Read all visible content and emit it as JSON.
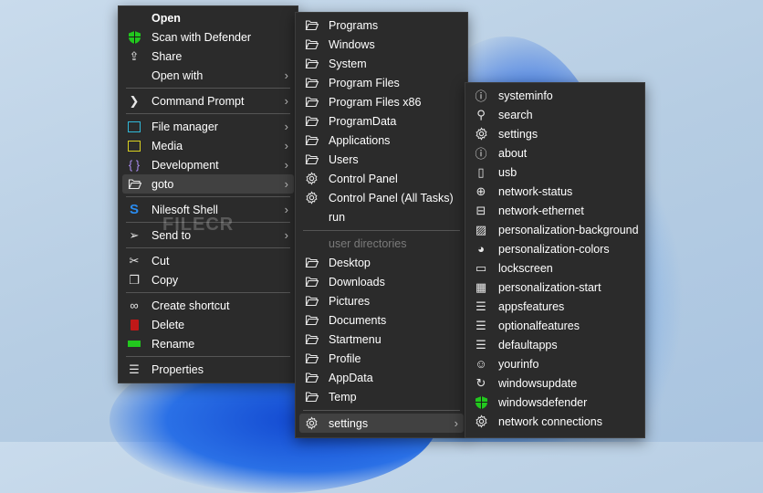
{
  "menus": {
    "main": [
      {
        "label": "Open",
        "bold": true,
        "icon": "none-icon"
      },
      {
        "label": "Scan with Defender",
        "icon": "shield-icon"
      },
      {
        "label": "Share",
        "icon": "share-icon"
      },
      {
        "label": "Open with",
        "icon": "none-icon",
        "sub": true
      },
      {
        "sep": true
      },
      {
        "label": "Command Prompt",
        "icon": "prompt-icon",
        "sub": true
      },
      {
        "sep": true
      },
      {
        "label": "File manager",
        "icon": "file-manager-icon",
        "sub": true
      },
      {
        "label": "Media",
        "icon": "media-icon",
        "sub": true
      },
      {
        "label": "Development",
        "icon": "braces-icon",
        "sub": true
      },
      {
        "label": "goto",
        "icon": "folder-icon",
        "sub": true,
        "hl": true
      },
      {
        "sep": true
      },
      {
        "label": "Nilesoft Shell",
        "icon": "nilesoft-icon",
        "sub": true
      },
      {
        "sep": true
      },
      {
        "label": "Send to",
        "icon": "send-icon",
        "sub": true
      },
      {
        "sep": true
      },
      {
        "label": "Cut",
        "icon": "cut-icon"
      },
      {
        "label": "Copy",
        "icon": "copy-icon"
      },
      {
        "sep": true
      },
      {
        "label": "Create shortcut",
        "icon": "link-icon"
      },
      {
        "label": "Delete",
        "icon": "delete-icon"
      },
      {
        "label": "Rename",
        "icon": "rename-icon"
      },
      {
        "sep": true
      },
      {
        "label": "Properties",
        "icon": "properties-icon"
      }
    ],
    "goto": [
      {
        "label": "Programs",
        "icon": "folder-icon"
      },
      {
        "label": "Windows",
        "icon": "folder-icon"
      },
      {
        "label": "System",
        "icon": "folder-icon"
      },
      {
        "label": "Program Files",
        "icon": "folder-icon"
      },
      {
        "label": "Program Files x86",
        "icon": "folder-icon"
      },
      {
        "label": "ProgramData",
        "icon": "folder-icon"
      },
      {
        "label": "Applications",
        "icon": "folder-icon"
      },
      {
        "label": "Users",
        "icon": "folder-icon"
      },
      {
        "label": "Control Panel",
        "icon": "gear-icon"
      },
      {
        "label": "Control Panel (All Tasks)",
        "icon": "gear-icon"
      },
      {
        "label": "run",
        "icon": "none-icon"
      },
      {
        "sep": true
      },
      {
        "label": "user directories",
        "icon": "none-icon",
        "dim": true
      },
      {
        "label": "Desktop",
        "icon": "folder-icon"
      },
      {
        "label": "Downloads",
        "icon": "folder-icon"
      },
      {
        "label": "Pictures",
        "icon": "folder-icon"
      },
      {
        "label": "Documents",
        "icon": "folder-icon"
      },
      {
        "label": "Startmenu",
        "icon": "folder-icon"
      },
      {
        "label": "Profile",
        "icon": "folder-icon"
      },
      {
        "label": "AppData",
        "icon": "folder-icon"
      },
      {
        "label": "Temp",
        "icon": "folder-icon"
      },
      {
        "sep": true
      },
      {
        "label": "settings",
        "icon": "gear-icon",
        "sub": true,
        "hl": true
      }
    ],
    "settings": [
      {
        "label": "systeminfo",
        "icon": "info-icon"
      },
      {
        "label": "search",
        "icon": "search-icon"
      },
      {
        "label": "settings",
        "icon": "gear-icon"
      },
      {
        "label": "about",
        "icon": "info-icon"
      },
      {
        "label": "usb",
        "icon": "usb-icon"
      },
      {
        "label": "network-status",
        "icon": "globe-icon"
      },
      {
        "label": "network-ethernet",
        "icon": "ethernet-icon"
      },
      {
        "label": "personalization-background",
        "icon": "image-icon"
      },
      {
        "label": "personalization-colors",
        "icon": "palette-icon"
      },
      {
        "label": "lockscreen",
        "icon": "lockscreen-icon"
      },
      {
        "label": "personalization-start",
        "icon": "start-icon"
      },
      {
        "label": "appsfeatures",
        "icon": "list-icon"
      },
      {
        "label": "optionalfeatures",
        "icon": "list-icon"
      },
      {
        "label": "defaultapps",
        "icon": "list-icon"
      },
      {
        "label": "yourinfo",
        "icon": "person-icon"
      },
      {
        "label": "windowsupdate",
        "icon": "refresh-icon"
      },
      {
        "label": "windowsdefender",
        "icon": "shield-icon"
      },
      {
        "label": "network connections",
        "icon": "gear-icon"
      }
    ]
  },
  "watermark": "FILECR",
  "colors": {
    "menu_bg": "#2b2b2b",
    "highlight": "#414141",
    "defender": "#22c81e",
    "delete": "#c01818",
    "rename": "#22c81e",
    "media": "#d8d020",
    "file_manager": "#30b8d8",
    "nilesoft": "#2a8cf0"
  }
}
